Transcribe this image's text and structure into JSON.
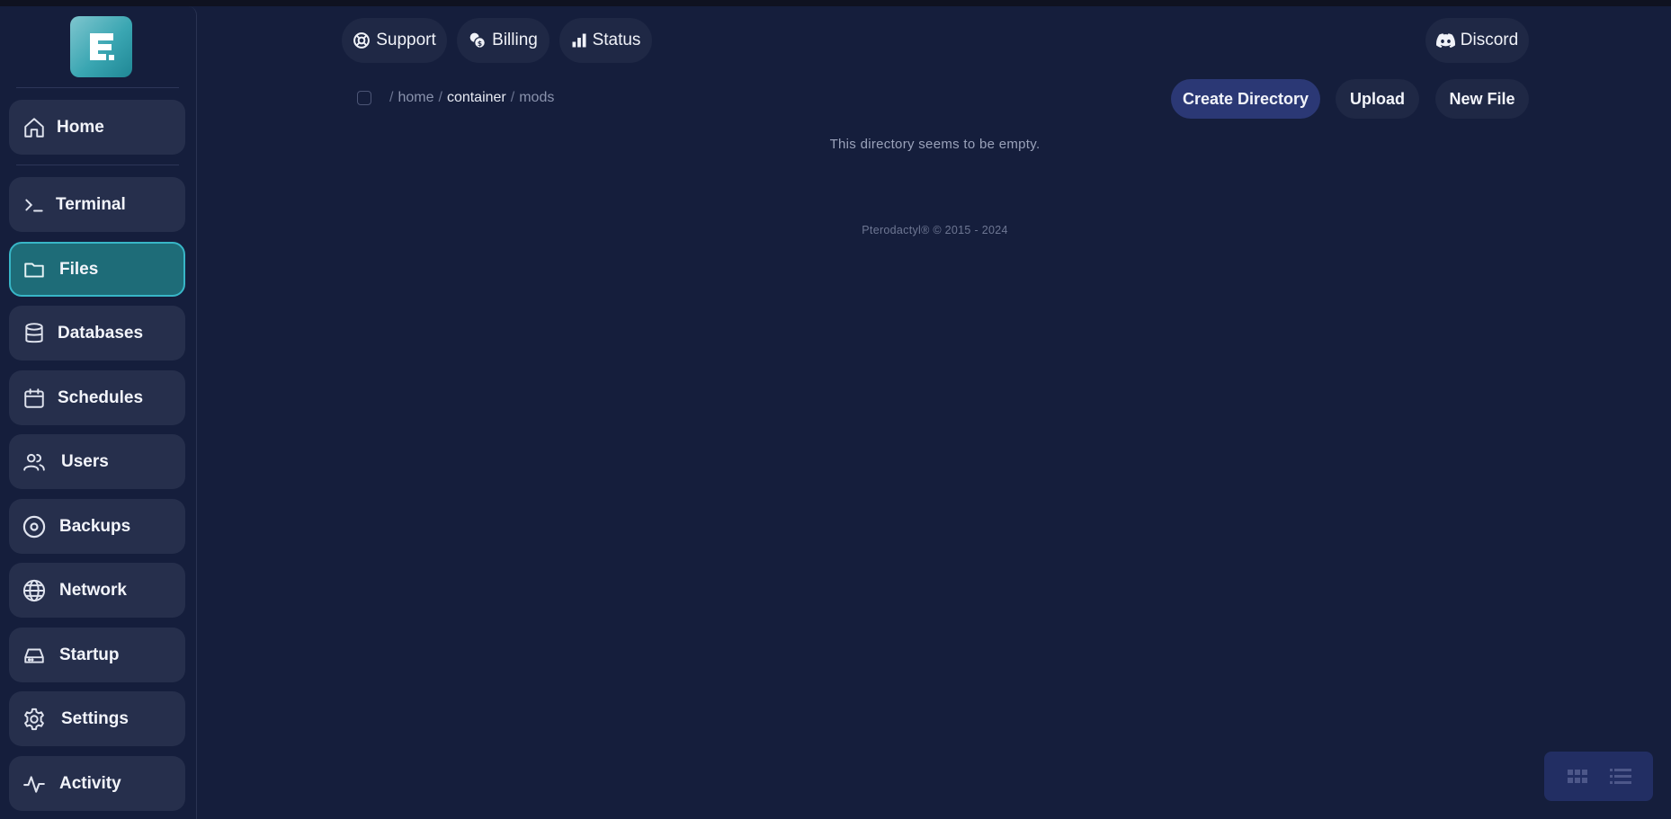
{
  "topnav": {
    "support_label": "Support",
    "billing_label": "Billing",
    "status_label": "Status",
    "discord_label": "Discord"
  },
  "sidebar": {
    "logo_icon": "panel-logo",
    "items": [
      {
        "label": "Home",
        "icon": "home-icon"
      },
      {
        "label": "Terminal",
        "icon": "terminal-icon"
      },
      {
        "label": "Files",
        "icon": "folder-icon",
        "active": true
      },
      {
        "label": "Databases",
        "icon": "database-icon"
      },
      {
        "label": "Schedules",
        "icon": "calendar-icon"
      },
      {
        "label": "Users",
        "icon": "users-icon"
      },
      {
        "label": "Backups",
        "icon": "disc-icon"
      },
      {
        "label": "Network",
        "icon": "globe-icon"
      },
      {
        "label": "Startup",
        "icon": "drive-icon"
      },
      {
        "label": "Settings",
        "icon": "gear-icon"
      },
      {
        "label": "Activity",
        "icon": "activity-icon"
      }
    ]
  },
  "breadcrumb": {
    "separator": "/",
    "parts": [
      "home",
      "container",
      "mods"
    ]
  },
  "actions": {
    "create_directory_label": "Create Directory",
    "upload_label": "Upload",
    "new_file_label": "New File"
  },
  "main": {
    "empty_message": "This directory seems to be empty."
  },
  "footer": {
    "text": "Pterodactyl® © 2015 - 2024"
  },
  "colors": {
    "background": "#151e3c",
    "nav_item": "#262f4c",
    "active_item": "#1e6c78",
    "active_border": "#38b6c7",
    "primary_button": "#2b3875"
  }
}
